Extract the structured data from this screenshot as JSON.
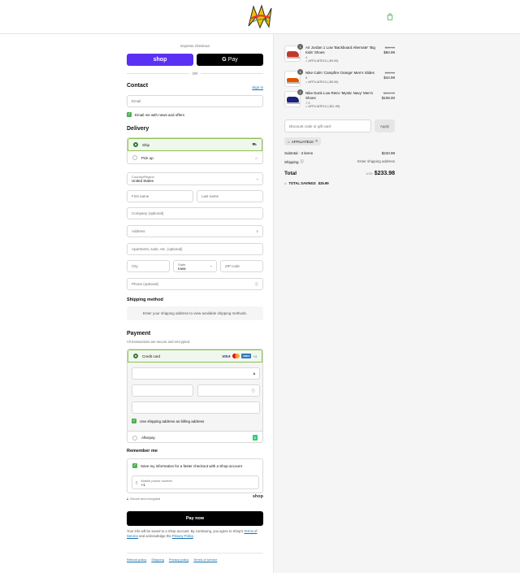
{
  "header": {
    "logo_alt": "store logo",
    "cart_icon": "bag-icon"
  },
  "express": {
    "label": "Express checkout",
    "shop_label": "shop",
    "gpay_label": "Pay",
    "gpay_g": "G",
    "or_label": "OR"
  },
  "contact": {
    "title": "Contact",
    "signin": "Sign in",
    "email_placeholder": "Email",
    "newsletter_label": "Email me with news and offers"
  },
  "delivery": {
    "title": "Delivery",
    "ship_label": "Ship",
    "pickup_label": "Pick up",
    "country_label": "Country/Region",
    "country_value": "United States",
    "first_name": "First name",
    "last_name": "Last name",
    "company": "Company (optional)",
    "address": "Address",
    "apartment": "Apartment, suite, etc. (optional)",
    "city": "City",
    "state_label": "State",
    "state_value": "Iowa",
    "zip": "ZIP code",
    "phone": "Phone (optional)"
  },
  "shipping_method": {
    "title": "Shipping method",
    "message": "Enter your shipping address to view available shipping methods."
  },
  "payment": {
    "title": "Payment",
    "subtitle": "All transactions are secure and encrypted.",
    "credit_card_label": "Credit card",
    "visa": "VISA",
    "amex": "AMEX",
    "more": "+4",
    "billing_label": "Use shipping address as billing address",
    "afterpay_label": "Afterpay"
  },
  "remember": {
    "title": "Remember me",
    "save_label": "Save my information for a faster checkout with a Shop account",
    "phone_label": "Mobile phone number",
    "phone_prefix": "+1",
    "secure": "Secure and encrypted",
    "shop": "shop"
  },
  "pay_now": "Pay now",
  "terms": {
    "text1": "Your info will be saved to a Shop account. By continuing, you agree to Shop's",
    "tos": "Terms of Service",
    "text2": "and acknowledge the",
    "privacy": "Privacy Policy",
    "end": "."
  },
  "footer": {
    "refund": "Refund policy",
    "shipping": "Shipping",
    "privacy": "Privacy policy",
    "terms": "Terms of service"
  },
  "cart": {
    "items": [
      {
        "qty": "1",
        "name": "Air Jordan 1 Low 'Backboard Alternate' 'Big Kids' Shoes",
        "size": "4",
        "discount": "AFFILIATE10 (-$9.00)",
        "old_price": "$69.99",
        "price": "$60.99",
        "color": "#c0392b"
      },
      {
        "qty": "1",
        "name": "Nike Calm 'Campfire Orange' Men's Slides",
        "size": "8",
        "discount": "AFFILIATE10 (-$5.00)",
        "old_price": "$49.99",
        "price": "$44.99",
        "color": "#e65100"
      },
      {
        "qty": "1",
        "name": "Nike Dunk Low Retro 'Mystic Navy' Men's Shoes",
        "size": "7.5",
        "discount": "AFFILIATE10 (-$11.99)",
        "old_price": "$119.99",
        "price": "$108.00",
        "color": "#1a237e"
      }
    ],
    "discount_placeholder": "Discount code or gift card",
    "apply": "Apply",
    "applied_code": "AFFILIATE10",
    "subtotal_label": "Subtotal · 3 items",
    "subtotal": "$233.98",
    "shipping_label": "Shipping",
    "shipping_value": "Enter shipping address",
    "total_label": "Total",
    "currency": "USD",
    "total": "$233.98",
    "savings_label": "TOTAL SAVINGS",
    "savings": "$25.99"
  }
}
